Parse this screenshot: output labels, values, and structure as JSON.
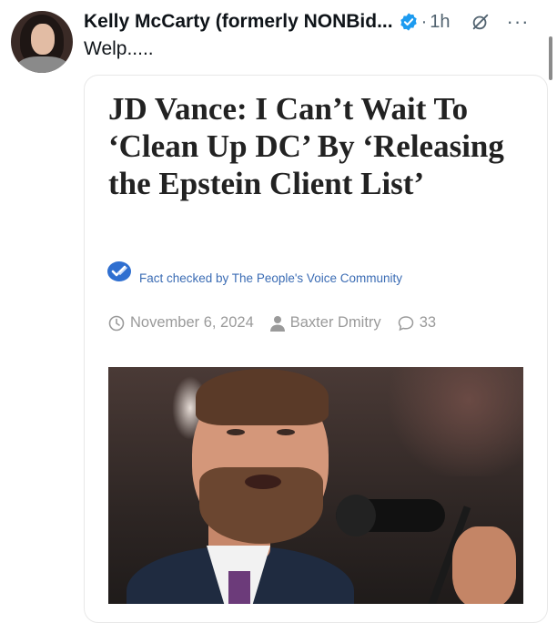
{
  "post": {
    "author_name": "Kelly McCarty (formerly NONBid...",
    "separator": "·",
    "time": "1h",
    "more": "···",
    "text": "Welp....."
  },
  "card": {
    "headline": "JD Vance: I Can’t Wait To ‘Clean Up DC’ By ‘Releasing the Epstein Client List’",
    "fact_check": "Fact checked by The People's Voice Community",
    "date": "November 6, 2024",
    "author": "Baxter Dmitry",
    "comments": "33"
  },
  "colors": {
    "verified": "#1d9bf0",
    "fact_check": "#3b6cb4",
    "meta": "#9a9a9a"
  },
  "icons": {
    "verified": "verified-badge-icon",
    "grok": "grok-icon",
    "clock": "clock-icon",
    "user": "user-icon",
    "comment": "comment-icon",
    "fact_check": "fact-check-icon"
  }
}
